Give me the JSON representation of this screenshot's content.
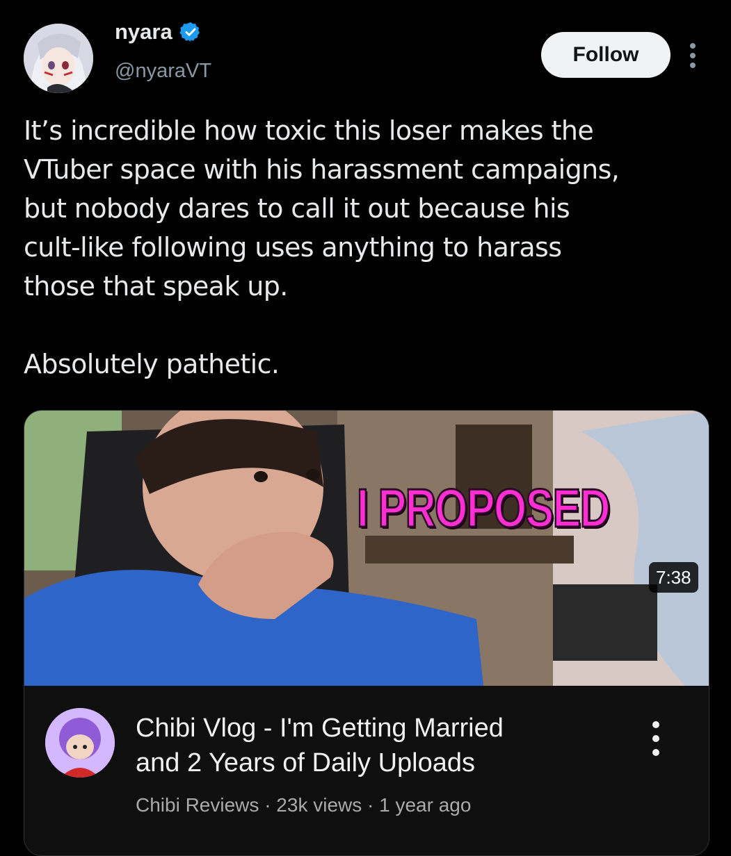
{
  "post": {
    "display_name": "nyara",
    "handle": "@nyaraVT",
    "follow_label": "Follow",
    "text": "It’s incredible how toxic this loser makes the\nVTuber space with his harassment campaigns,\nbut nobody dares to call it out because his\ncult-like following uses anything to harass\nthose that speak up.\n\nAbsolutely pathetic.",
    "colors": {
      "background": "#000000",
      "verified": "#1d9bf0",
      "handle": "#8b98a5"
    }
  },
  "video_card": {
    "thumbnail_text": "I PROPOSED",
    "duration": "7:38",
    "title": "Chibi Vlog - I'm Getting Married\nand 2 Years of Daily Uploads",
    "channel": "Chibi Reviews",
    "separator": "·",
    "views": "23k views",
    "age": "1 year ago",
    "colors": {
      "title_overlay": "#ff2fd3",
      "card_bg": "#0f0f0f"
    }
  },
  "icons": {
    "verified": "verified-badge-icon",
    "more": "more-vertical-icon"
  }
}
